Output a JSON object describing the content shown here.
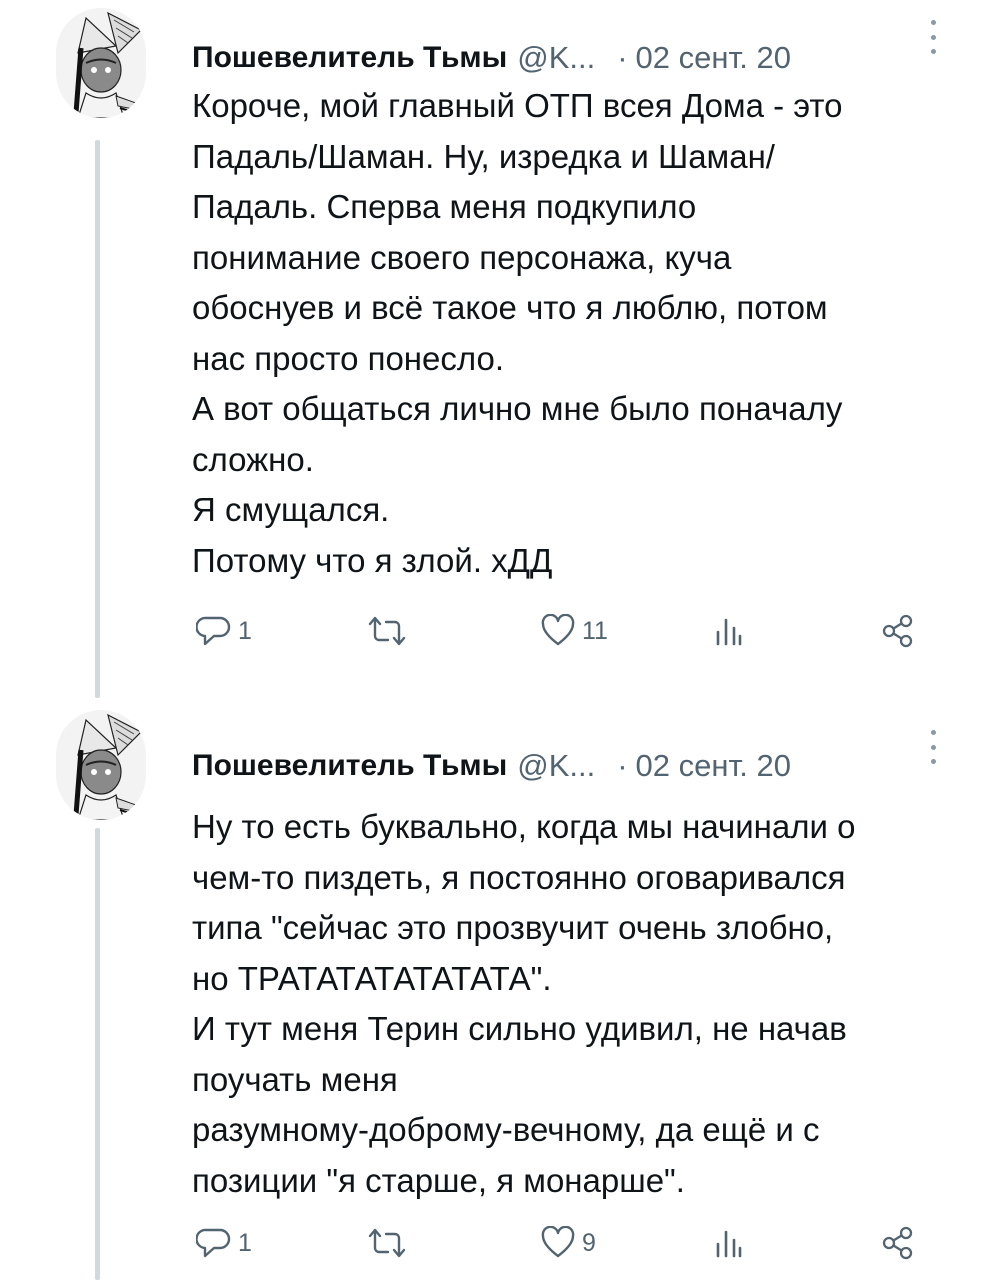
{
  "tweets": [
    {
      "author": {
        "display_name": "Пошевелитель Тьмы",
        "handle": "@K...",
        "avatar": "avatar-illustration"
      },
      "separator": "·",
      "date": "02 сент. 20",
      "lines": [
        "Короче, мой главный ОТП всея Дома - это",
        "Падаль/Шаман. Ну, изредка и Шаман/",
        "Падаль. Сперва меня подкупило",
        "понимание своего персонажа, куча",
        "обоснуев и всё такое что я люблю, потом",
        "нас просто понесло.",
        "А вот общаться лично мне было поначалу",
        "сложно.",
        "Я смущался.",
        "Потому что я злой. хДД"
      ],
      "actions": {
        "reply_count": "1",
        "retweet_count": "",
        "like_count": "11",
        "views_count": "",
        "share_icon": "share-icon"
      }
    },
    {
      "author": {
        "display_name": "Пошевелитель Тьмы",
        "handle": "@K...",
        "avatar": "avatar-illustration"
      },
      "separator": "·",
      "date": "02 сент. 20",
      "lines": [
        "Ну то есть буквально, когда мы начинали о",
        "чем-то пиздеть, я постоянно оговаривался",
        "типа \"сейчас это прозвучит очень злобно,",
        "но ТРАТАТАТАТАТАТА\".",
        "И тут меня Терин сильно удивил, не начав",
        "поучать меня",
        "разумному-доброму-вечному, да ещё и с",
        "позиции \"я старше, я монарше\"."
      ],
      "actions": {
        "reply_count": "1",
        "retweet_count": "",
        "like_count": "9",
        "views_count": "",
        "share_icon": "share-icon"
      }
    }
  ],
  "colors": {
    "text": "#0f1419",
    "secondary": "#536471",
    "thread_line": "#cfd9de",
    "background": "#ffffff"
  }
}
